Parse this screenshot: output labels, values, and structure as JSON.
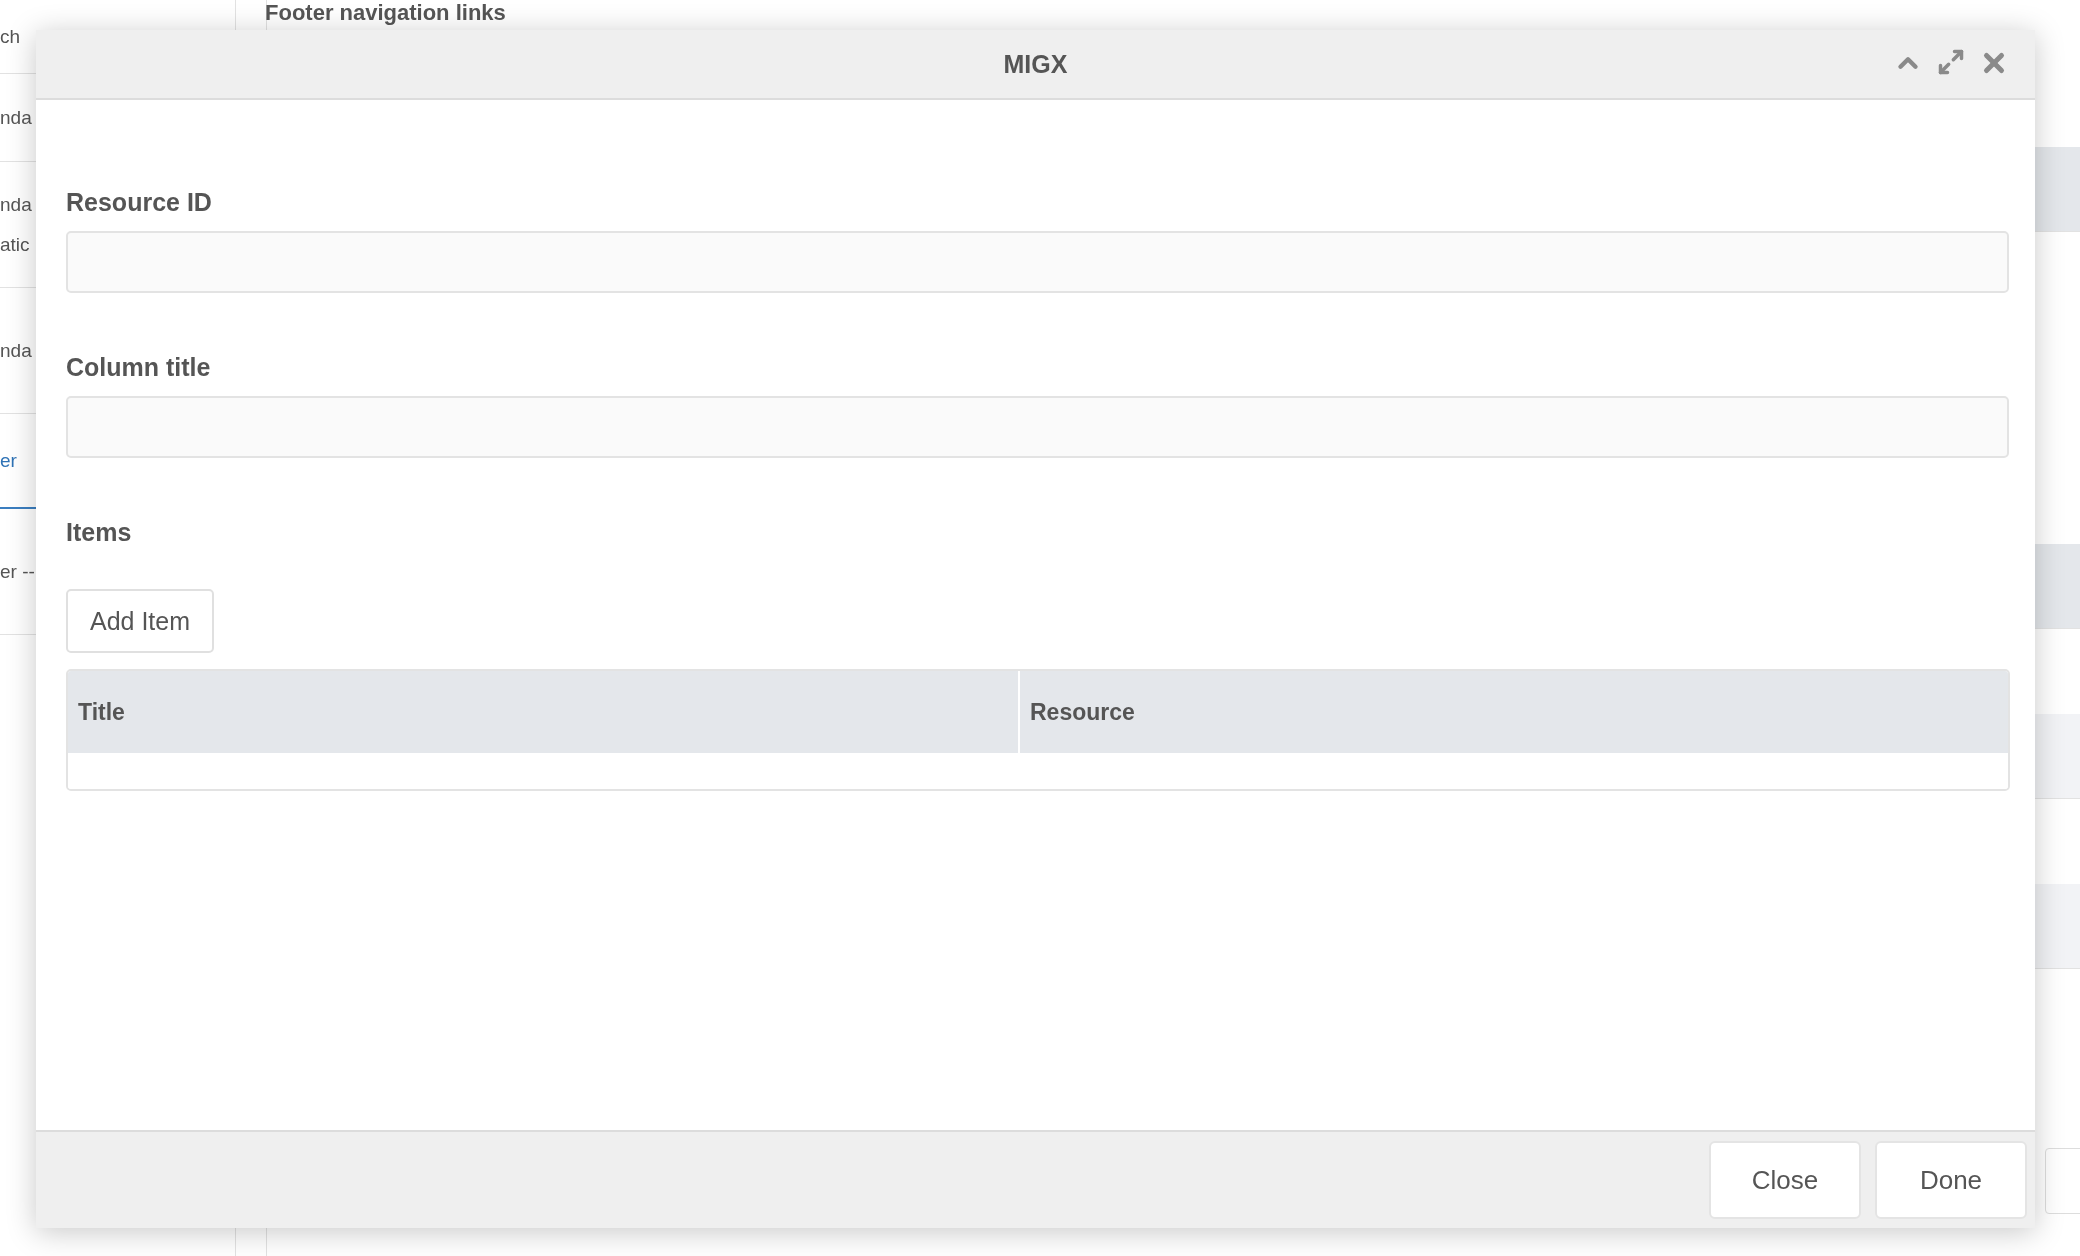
{
  "background": {
    "sidebar_items": [
      {
        "lines": [
          "ch"
        ],
        "selected": false
      },
      {
        "lines": [
          "nda"
        ],
        "selected": false
      },
      {
        "lines": [
          "nda",
          "atic"
        ],
        "selected": false
      },
      {
        "lines": [
          "nda"
        ],
        "selected": false
      },
      {
        "lines": [
          "er"
        ],
        "selected": true
      },
      {
        "lines": [
          "er --"
        ],
        "selected": false
      }
    ],
    "heading": "Footer navigation links"
  },
  "dialog": {
    "title": "MIGX",
    "fields": [
      {
        "label": "Resource ID"
      },
      {
        "label": "Column title"
      }
    ],
    "items_label": "Items",
    "add_button": "Add Item",
    "grid": {
      "columns": [
        "Title",
        "Resource"
      ]
    },
    "buttons": [
      "Close",
      "Done"
    ]
  }
}
